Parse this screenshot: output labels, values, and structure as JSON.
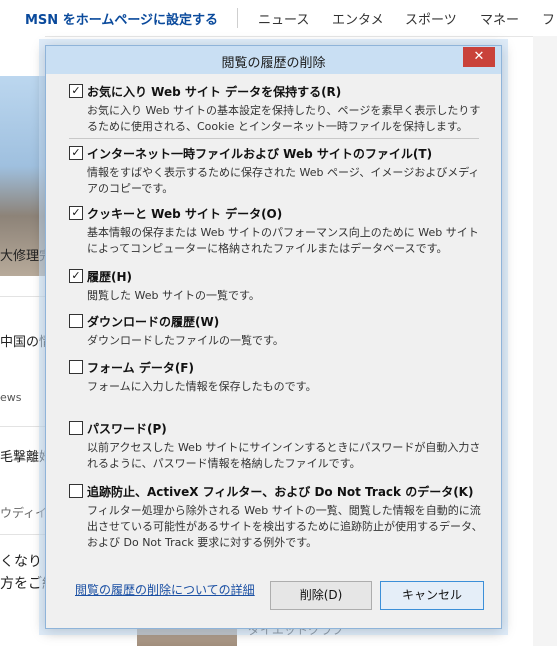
{
  "page": {
    "msn_link": "MSN をホームページに設定する",
    "nav": [
      "ニュース",
      "エンタメ",
      "スポーツ",
      "マネー",
      "フ"
    ],
    "left_snippets": [
      "大修理完",
      "中国の情",
      "ews",
      "毛撃離婚",
      "ウディイ",
      "くなり",
      "方をご紹"
    ],
    "bottom_text": "ダイエットクラブ"
  },
  "dialog": {
    "title": "閲覧の履歴の削除",
    "close_symbol": "✕",
    "options": [
      {
        "checked": true,
        "checkmark": "✓",
        "label": "お気に入り Web サイト データを保持する(R)",
        "description": "お気に入り Web サイトの基本設定を保持したり、ページを素早く表示したりするために使用される、Cookie とインターネット一時ファイルを保持します。"
      },
      {
        "checked": true,
        "checkmark": "✓",
        "label": "インターネット一時ファイルおよび Web サイトのファイル(T)",
        "description": "情報をすばやく表示するために保存された Web ページ、イメージおよびメディアのコピーです。"
      },
      {
        "checked": true,
        "checkmark": "✓",
        "label": "クッキーと Web サイト データ(O)",
        "description": "基本情報の保存または Web サイトのパフォーマンス向上のために Web サイトによってコンピューターに格納されたファイルまたはデータベースです。"
      },
      {
        "checked": true,
        "checkmark": "✓",
        "label": "履歴(H)",
        "description": "閲覧した Web サイトの一覧です。"
      },
      {
        "checked": false,
        "checkmark": "",
        "label": "ダウンロードの履歴(W)",
        "description": "ダウンロードしたファイルの一覧です。"
      },
      {
        "checked": false,
        "checkmark": "",
        "label": "フォーム データ(F)",
        "description": "フォームに入力した情報を保存したものです。"
      },
      {
        "checked": false,
        "checkmark": "",
        "label": "パスワード(P)",
        "description": "以前アクセスした Web サイトにサインインするときにパスワードが自動入力されるように、パスワード情報を格納したファイルです。"
      },
      {
        "checked": false,
        "checkmark": "",
        "label": "追跡防止、ActiveX フィルター、および Do Not Track のデータ(K)",
        "description": "フィルター処理から除外される Web サイトの一覧、閲覧した情報を自動的に流出させている可能性があるサイトを検出するために追跡防止が使用するデータ、および Do Not Track 要求に対する例外です。"
      }
    ],
    "details_link": "閲覧の履歴の削除についての詳細",
    "delete_button": "削除(D)",
    "cancel_button": "キャンセル"
  },
  "colors": {
    "title_bar": "#c9dff3",
    "close_button": "#c9423a",
    "link": "#1a4fa3",
    "msn_link": "#0a4a9c"
  }
}
